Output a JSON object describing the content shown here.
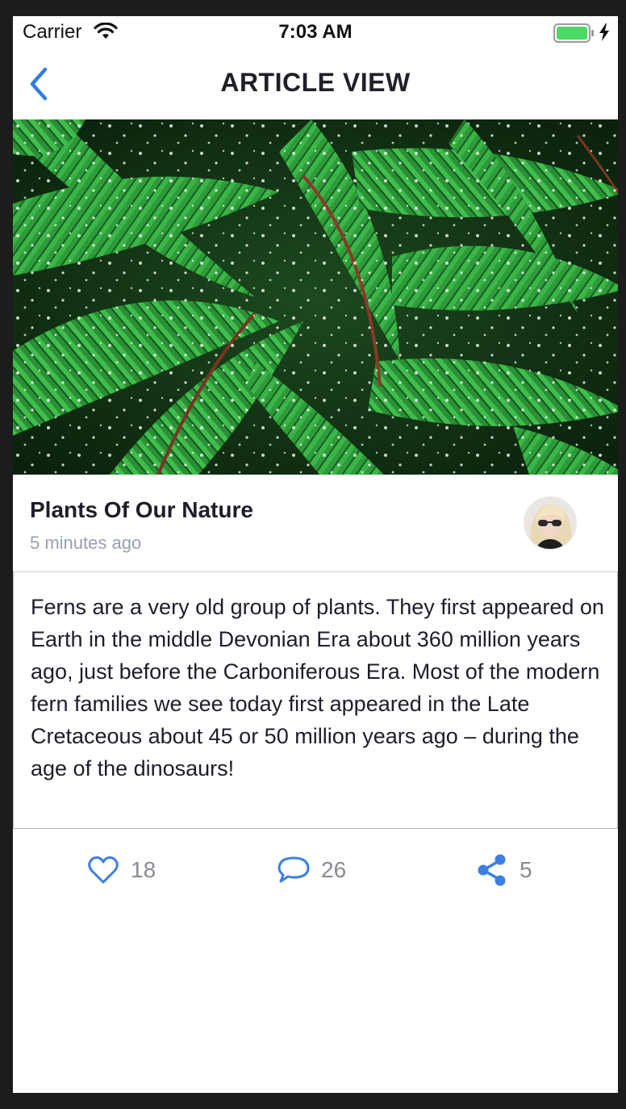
{
  "status_bar": {
    "carrier": "Carrier",
    "time": "7:03 AM",
    "battery_color": "#4cd964"
  },
  "nav": {
    "title": "ARTICLE VIEW",
    "back_icon": "chevron-left-icon",
    "accent_color": "#2f7de1"
  },
  "article": {
    "image": "fern-leaves-photo",
    "title": "Plants Of Our Nature",
    "time_ago": "5 minutes ago",
    "author_avatar": "avatar-photo",
    "body": "Ferns are a very old group of plants. They first appeared on Earth in the middle Devonian Era about 360 million years ago, just before the Carboniferous Era. Most of the modern fern families we see today first appeared in the Late Cretaceous about 45 or 50 million years ago – during the age of the dinosaurs!"
  },
  "actions": {
    "likes": "18",
    "comments": "26",
    "shares": "5",
    "icon_color": "#3d7fe0"
  }
}
